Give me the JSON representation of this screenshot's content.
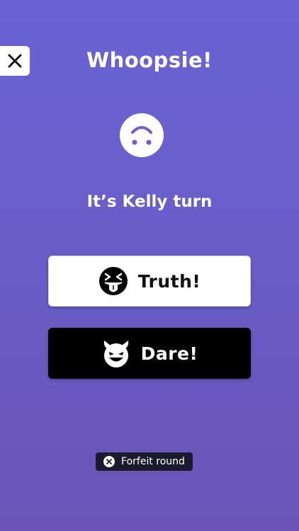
{
  "header": {
    "title": "Whoopsie!",
    "close_icon": "close-icon"
  },
  "status": {
    "face_icon": "upside-down-face-icon",
    "turn_text": "It’s Kelly turn"
  },
  "choices": {
    "truth": {
      "label": "Truth!",
      "icon": "squinting-tongue-face-icon"
    },
    "dare": {
      "label": "Dare!",
      "icon": "smiling-devil-face-icon"
    }
  },
  "footer": {
    "forfeit_label": "Forfeit round",
    "forfeit_icon": "x-circle-icon"
  },
  "colors": {
    "background_top": "#6a63d6",
    "background_bottom": "#6a55b6",
    "truth_bg": "#ffffff",
    "dare_bg": "#000000",
    "forfeit_bg": "#1c1a2e"
  }
}
